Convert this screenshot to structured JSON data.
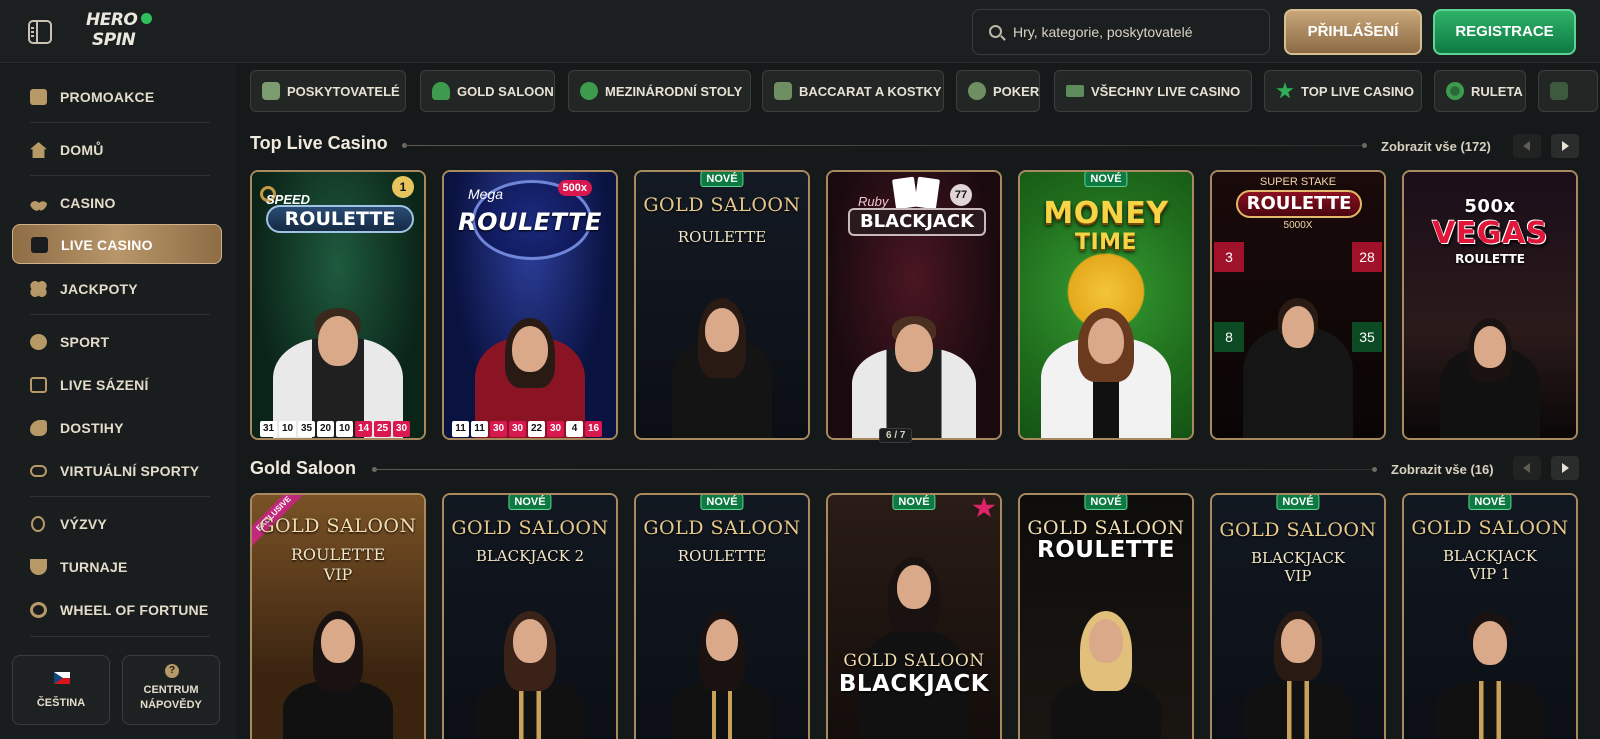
{
  "header": {
    "logo_text_1": "HERO",
    "logo_text_2": "SPIN",
    "search_placeholder": "Hry, kategorie, poskytovatelé",
    "login_label": "PŘIHLÁŠENÍ",
    "register_label": "REGISTRACE"
  },
  "sidebar": {
    "items": [
      {
        "label": "PROMOAKCE",
        "icon": "gift-icon"
      },
      {
        "label": "DOMŮ",
        "icon": "home-icon"
      },
      {
        "label": "CASINO",
        "icon": "cherries-icon"
      },
      {
        "label": "LIVE CASINO",
        "icon": "live-cards-icon",
        "active": true
      },
      {
        "label": "JACKPOTY",
        "icon": "clover-icon"
      },
      {
        "label": "SPORT",
        "icon": "soccer-ball-icon"
      },
      {
        "label": "LIVE SÁZENÍ",
        "icon": "live-bet-icon"
      },
      {
        "label": "DOSTIHY",
        "icon": "horse-icon"
      },
      {
        "label": "VIRTUÁLNÍ SPORTY",
        "icon": "gamepad-icon"
      },
      {
        "label": "VÝZVY",
        "icon": "medal-icon"
      },
      {
        "label": "TURNAJE",
        "icon": "trophy-icon"
      },
      {
        "label": "WHEEL OF FORTUNE",
        "icon": "wheel-icon"
      }
    ],
    "language_label": "ČEŠTINA",
    "help_label_1": "CENTRUM",
    "help_label_2": "NÁPOVĚDY"
  },
  "categories": [
    {
      "label": "POSKYTOVATELÉ",
      "icon": "providers-icon"
    },
    {
      "label": "GOLD SALOON",
      "icon": "fleur-icon"
    },
    {
      "label": "MEZINÁRODNÍ STOLY",
      "icon": "globe-icon"
    },
    {
      "label": "BACCARAT A KOSTKY",
      "icon": "dice-icon"
    },
    {
      "label": "POKER",
      "icon": "poker-chips-icon"
    },
    {
      "label": "VŠECHNY LIVE CASINO",
      "icon": "cash-icon"
    },
    {
      "label": "TOP LIVE CASINO",
      "icon": "star-icon"
    },
    {
      "label": "RULETA",
      "icon": "roulette-icon"
    }
  ],
  "sections": [
    {
      "title": "Top Live Casino",
      "show_all": "Zobrazit vše (172)",
      "games": [
        {
          "title_small": "SPEED",
          "title": "ROULETTE",
          "badge": "1",
          "numbers": [
            "31",
            "10",
            "35",
            "20",
            "10",
            "14",
            "25",
            "30"
          ],
          "red": [
            5,
            6,
            7
          ]
        },
        {
          "title_small": "Mega",
          "title": "ROULETTE",
          "badge": "500x",
          "numbers": [
            "11",
            "11",
            "30",
            "30",
            "22",
            "30",
            "4",
            "16"
          ],
          "red": [
            2,
            3,
            5,
            7
          ]
        },
        {
          "new": "NOVÉ",
          "title": "GOLD SALOON",
          "subtitle": "ROULETTE"
        },
        {
          "title_small": "Ruby",
          "title": "BLACKJACK",
          "badge": "77",
          "pager": "6 / 7"
        },
        {
          "new": "NOVÉ",
          "title": "MONEY",
          "subtitle": "TIME"
        },
        {
          "title_small": "SUPER STAKE",
          "title": "ROULETTE",
          "subtitle": "5000X"
        },
        {
          "title_small": "500x",
          "title": "VEGAS",
          "subtitle": "ROULETTE"
        }
      ]
    },
    {
      "title": "Gold Saloon",
      "show_all": "Zobrazit vše (16)",
      "games": [
        {
          "ribbon": "EXCLUSIVE",
          "title": "GOLD SALOON",
          "subtitle": "ROULETTE",
          "subtitle2": "VIP"
        },
        {
          "new": "NOVÉ",
          "title": "GOLD SALOON",
          "subtitle": "BLACKJACK 2"
        },
        {
          "new": "NOVÉ",
          "title": "GOLD SALOON",
          "subtitle": "ROULETTE"
        },
        {
          "new": "NOVÉ",
          "title": "GOLD SALOON",
          "subtitle": "BLACKJACK"
        },
        {
          "new": "NOVÉ",
          "title": "GOLD SALOON",
          "subtitle": "ROULETTE"
        },
        {
          "new": "NOVÉ",
          "title": "GOLD SALOON",
          "subtitle": "BLACKJACK",
          "subtitle2": "VIP"
        },
        {
          "new": "NOVÉ",
          "title": "GOLD SALOON",
          "subtitle": "BLACKJACK",
          "subtitle2": "VIP 1"
        }
      ]
    }
  ],
  "colors": {
    "accent_gold": "#b79968",
    "accent_green": "#0d7a42",
    "background": "#16191a"
  }
}
